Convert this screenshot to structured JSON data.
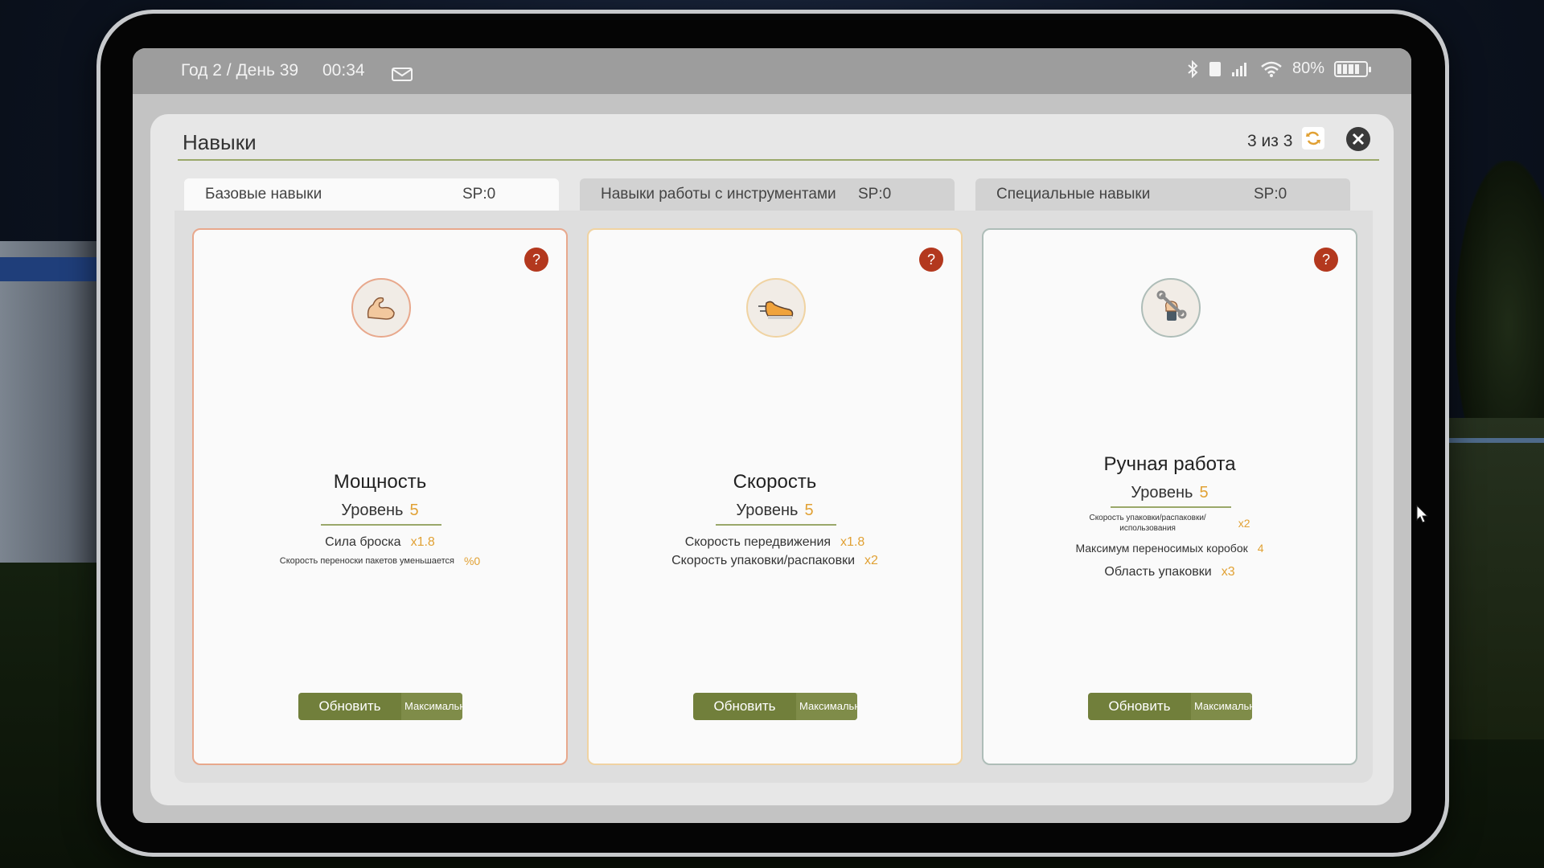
{
  "status_bar": {
    "date": "Год 2 / День 39",
    "time": "00:34",
    "battery": "80%",
    "icons": [
      "mail-icon",
      "bluetooth-icon",
      "sim-icon",
      "signal-icon",
      "wifi-icon",
      "battery-icon"
    ]
  },
  "window": {
    "title": "Навыки",
    "page_count": "3 из 3",
    "close_icon": "close-icon",
    "refresh_icon": "refresh-icon"
  },
  "tabs": [
    {
      "label": "Базовые навыки",
      "sp": "SP:0",
      "active": true
    },
    {
      "label": "Навыки работы с инструментами",
      "sp": "SP:0",
      "active": false
    },
    {
      "label": "Специальные навыки",
      "sp": "SP:0",
      "active": false
    }
  ],
  "cards": [
    {
      "icon": "flexed-arm-icon",
      "name": "Мощность",
      "level_label": "Уровень",
      "level": "5",
      "stats": [
        {
          "label": "Сила броска",
          "value": "x1.8"
        },
        {
          "label": "Скорость переноски пакетов уменьшается",
          "value": "%0"
        }
      ],
      "upgrade_label": "Обновить",
      "max_label": "Максимальный"
    },
    {
      "icon": "running-shoe-icon",
      "name": "Скорость",
      "level_label": "Уровень",
      "level": "5",
      "stats": [
        {
          "label": "Скорость передвижения",
          "value": "x1.8"
        },
        {
          "label": "Скорость упаковки/распаковки",
          "value": "x2"
        }
      ],
      "upgrade_label": "Обновить",
      "max_label": "Максимальный"
    },
    {
      "icon": "wrench-hand-icon",
      "name": "Ручная работа",
      "level_label": "Уровень",
      "level": "5",
      "stats": [
        {
          "label": "Скорость упаковки/распаковки/",
          "label2": "использования",
          "value": "x2"
        },
        {
          "label": "Максимум переносимых коробок",
          "value": "4"
        },
        {
          "label": "Область упаковки",
          "value": "x3"
        }
      ],
      "upgrade_label": "Обновить",
      "max_label": "Максимальный"
    }
  ],
  "colors": {
    "accent_olive": "#717f3b",
    "value_orange": "#e1a134",
    "help_red": "#b3381e"
  }
}
